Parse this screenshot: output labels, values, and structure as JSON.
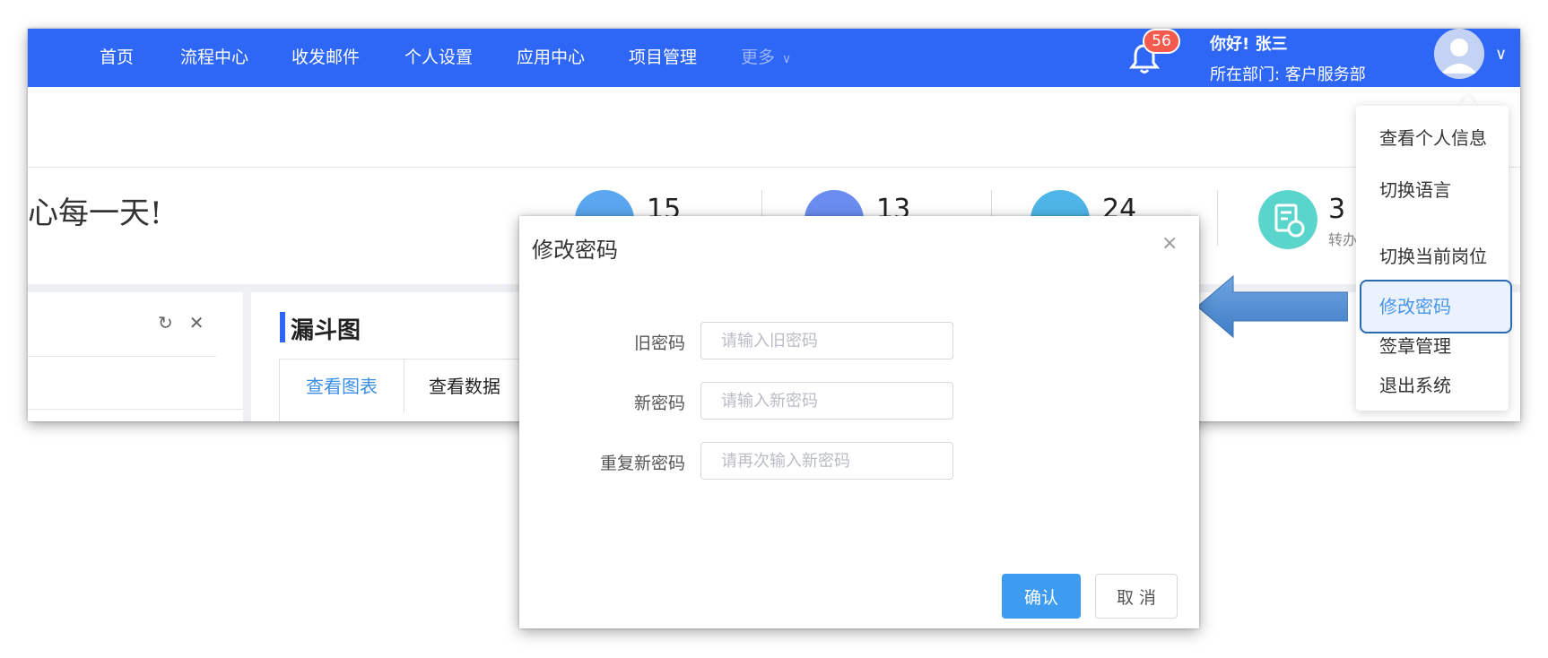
{
  "nav": {
    "items": [
      "首页",
      "流程中心",
      "收发邮件",
      "个人设置",
      "应用中心",
      "项目管理"
    ],
    "more_label": "更多"
  },
  "notifications": {
    "badge_count": "56"
  },
  "user": {
    "greeting": "你好! 张三",
    "department": "所在部门: 客户服务部"
  },
  "welcome": {
    "text": "心每一天!"
  },
  "stats": [
    {
      "value": "15",
      "label": "",
      "color": "#5aa7f0"
    },
    {
      "value": "13",
      "label": "",
      "color": "#6b8df0"
    },
    {
      "value": "24",
      "label": "",
      "color": "#4fb5e8"
    },
    {
      "value": "3",
      "label": "转办",
      "color": "#5ad5cc"
    }
  ],
  "left_card": {
    "tools": [
      "↻",
      "✕"
    ]
  },
  "funnel": {
    "title": "漏斗图",
    "tabs": [
      "查看图表",
      "查看数据"
    ]
  },
  "dropdown": {
    "items": [
      "查看个人信息",
      "切换语言",
      "切换当前岗位",
      "修改密码",
      "签章管理",
      "退出系统"
    ],
    "active_index": 3
  },
  "modal": {
    "title": "修改密码",
    "close_symbol": "×",
    "fields": [
      {
        "label": "旧密码",
        "placeholder": "请输入旧密码",
        "value": ""
      },
      {
        "label": "新密码",
        "placeholder": "请输入新密码",
        "value": ""
      },
      {
        "label": "重复新密码",
        "placeholder": "请再次输入新密码",
        "value": ""
      }
    ],
    "confirm_label": "确认",
    "cancel_label": "取 消"
  },
  "colors": {
    "topbar": "#2e66f5",
    "primary_button": "#3d9bf0",
    "active_menu_text": "#4a95e8",
    "badge": "#f55a4e",
    "callout_arrow": "#4b89d1"
  }
}
